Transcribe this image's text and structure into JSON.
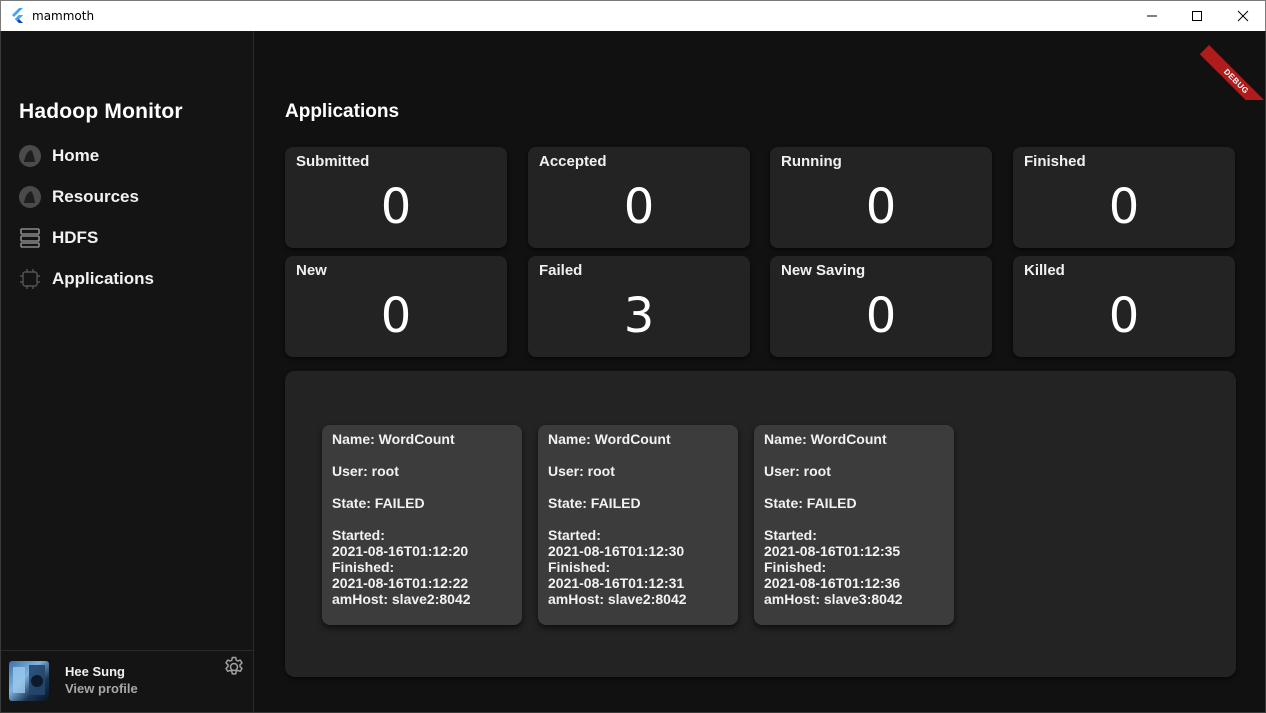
{
  "window": {
    "title": "mammoth",
    "debug_banner": "DEBUG"
  },
  "sidebar": {
    "brand": "Hadoop Monitor",
    "items": [
      {
        "label": "Home",
        "icon": "home-icon"
      },
      {
        "label": "Resources",
        "icon": "resources-icon"
      },
      {
        "label": "HDFS",
        "icon": "hdfs-icon"
      },
      {
        "label": "Applications",
        "icon": "applications-icon"
      }
    ],
    "profile": {
      "name": "Hee Sung",
      "link": "View profile"
    }
  },
  "main": {
    "title": "Applications",
    "stats": [
      {
        "label": "Submitted",
        "value": "0"
      },
      {
        "label": "Accepted",
        "value": "0"
      },
      {
        "label": "Running",
        "value": "0"
      },
      {
        "label": "Finished",
        "value": "0"
      },
      {
        "label": "New",
        "value": "0"
      },
      {
        "label": "Failed",
        "value": "3"
      },
      {
        "label": "New Saving",
        "value": "0"
      },
      {
        "label": "Killed",
        "value": "0"
      }
    ],
    "apps": [
      {
        "name": "Name: WordCount",
        "user": "User: root",
        "state": "State: FAILED",
        "started_label": "Started:",
        "started": "2021-08-16T01:12:20",
        "finished_label": "Finished:",
        "finished": "2021-08-16T01:12:22",
        "amhost": "amHost: slave2:8042"
      },
      {
        "name": "Name: WordCount",
        "user": "User: root",
        "state": "State: FAILED",
        "started_label": "Started:",
        "started": "2021-08-16T01:12:30",
        "finished_label": "Finished:",
        "finished": "2021-08-16T01:12:31",
        "amhost": "amHost: slave2:8042"
      },
      {
        "name": "Name: WordCount",
        "user": "User: root",
        "state": "State: FAILED",
        "started_label": "Started:",
        "started": "2021-08-16T01:12:35",
        "finished_label": "Finished:",
        "finished": "2021-08-16T01:12:36",
        "amhost": "amHost: slave3:8042"
      }
    ]
  },
  "colors": {
    "background": "#111111",
    "sidebar": "#141414",
    "card": "#232323",
    "app_card": "#3c3c3c",
    "debug": "#b01c1c"
  }
}
